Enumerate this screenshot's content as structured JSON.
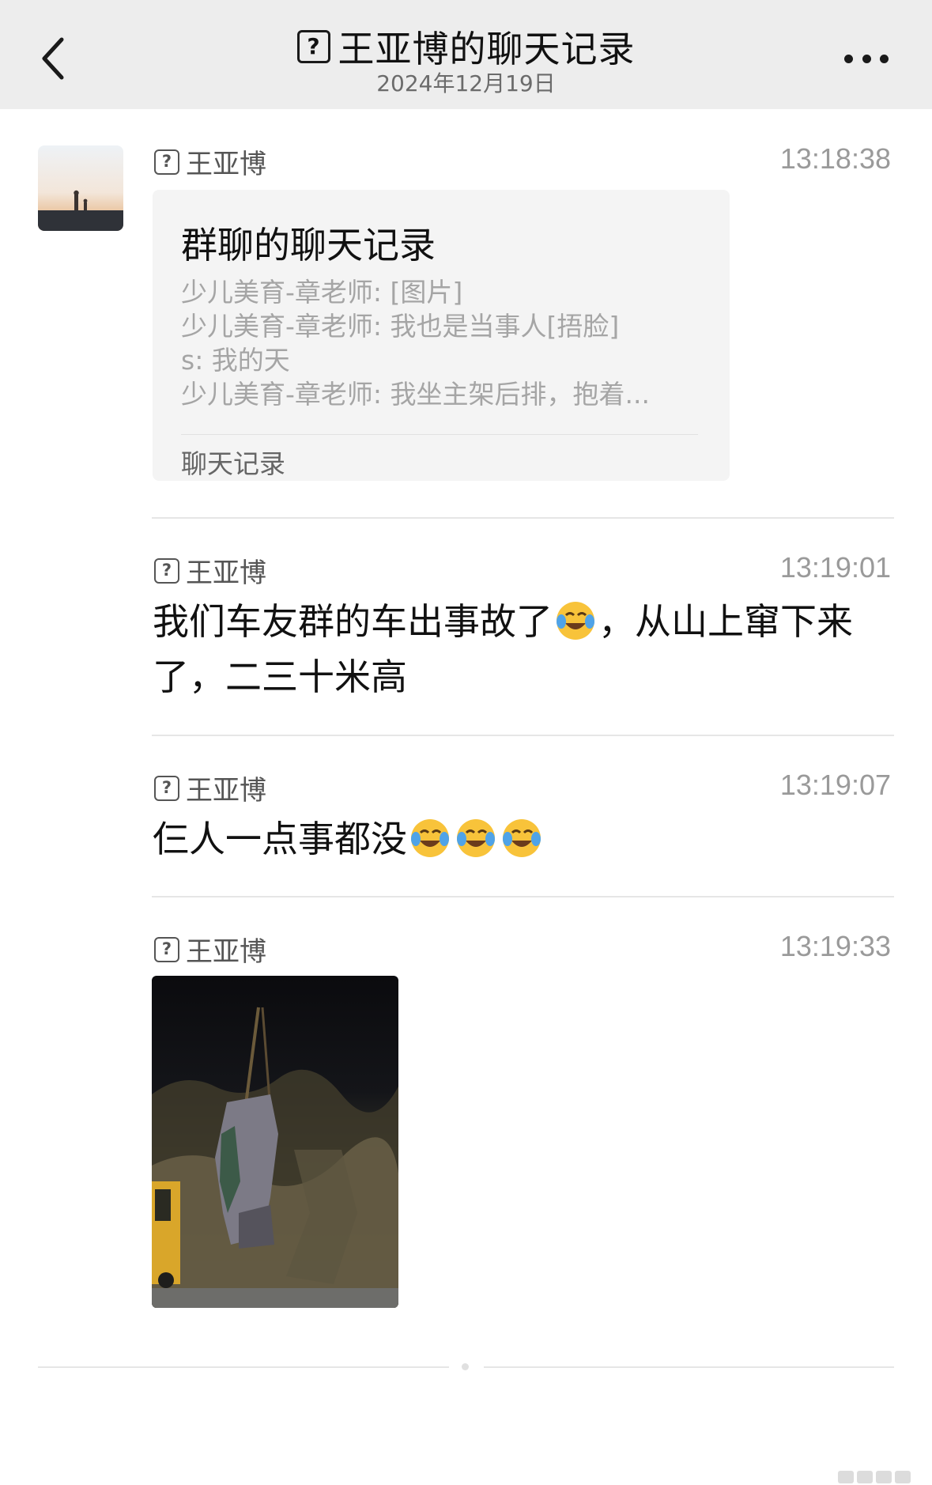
{
  "header": {
    "title": "王亚博的聊天记录",
    "date": "2024年12月19日",
    "unknown_avatar_glyph": "?"
  },
  "messages": [
    {
      "sender": "王亚博",
      "time": "13:18:38",
      "type": "chat-record-card",
      "card": {
        "title": "群聊的聊天记录",
        "lines": [
          "少儿美育-章老师: [图片]",
          "少儿美育-章老师: 我也是当事人[捂脸]",
          "s: 我的天",
          "少儿美育-章老师: 我坐主架后排，抱着..."
        ],
        "footer": "聊天记录"
      }
    },
    {
      "sender": "王亚博",
      "time": "13:19:01",
      "type": "text",
      "text_before": "我们车友群的车出事故了",
      "text_after": "，从山上窜下来了，二三十米高",
      "emoji": "face-with-tears-of-joy"
    },
    {
      "sender": "王亚博",
      "time": "13:19:07",
      "type": "text",
      "text_before": "仨人一点事都没",
      "emoji_count": 3,
      "emoji": "face-with-tears-of-joy"
    },
    {
      "sender": "王亚博",
      "time": "13:19:33",
      "type": "image",
      "image_desc": "wrecked car hoisted by crane at night"
    }
  ],
  "icons": {
    "back": "chevron-left-icon",
    "more": "ellipsis-icon",
    "unknown": "question-box-icon"
  },
  "colors": {
    "header_bg": "#ededed",
    "card_bg": "#f4f4f4",
    "muted_text": "#a5a5a5",
    "time_text": "#9a9a9a"
  }
}
